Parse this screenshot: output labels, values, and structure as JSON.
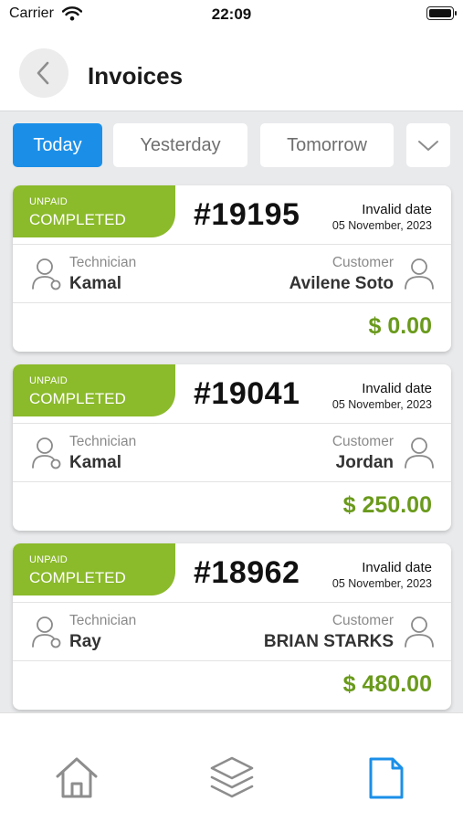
{
  "status_bar": {
    "carrier": "Carrier",
    "time": "22:09"
  },
  "header": {
    "title": "Invoices"
  },
  "filters": {
    "tabs": [
      {
        "label": "Today",
        "active": true
      },
      {
        "label": "Yesterday",
        "active": false
      },
      {
        "label": "Tomorrow",
        "active": false
      }
    ],
    "dropdown_icon": "chevron-down-icon"
  },
  "colors": {
    "accent": "#1b8fe8",
    "status_green": "#8bba2b",
    "amount_green": "#6a9a1c"
  },
  "invoices": [
    {
      "pay_status": "UNPAID",
      "job_status": "COMPLETED",
      "number": "#19195",
      "date_title": "Invalid date",
      "date": "05 November, 2023",
      "technician_label": "Technician",
      "technician": "Kamal",
      "customer_label": "Customer",
      "customer": "Avilene Soto",
      "amount": "$ 0.00"
    },
    {
      "pay_status": "UNPAID",
      "job_status": "COMPLETED",
      "number": "#19041",
      "date_title": "Invalid date",
      "date": "05 November, 2023",
      "technician_label": "Technician",
      "technician": "Kamal",
      "customer_label": "Customer",
      "customer": "Jordan",
      "amount": "$ 250.00"
    },
    {
      "pay_status": "UNPAID",
      "job_status": "COMPLETED",
      "number": "#18962",
      "date_title": "Invalid date",
      "date": "05 November, 2023",
      "technician_label": "Technician",
      "technician": "Ray",
      "customer_label": "Customer",
      "customer": "BRIAN STARKS",
      "amount": "$ 480.00"
    }
  ],
  "tabbar": {
    "items": [
      {
        "icon": "home-icon",
        "active": false
      },
      {
        "icon": "layers-icon",
        "active": false
      },
      {
        "icon": "document-icon",
        "active": true
      }
    ]
  }
}
